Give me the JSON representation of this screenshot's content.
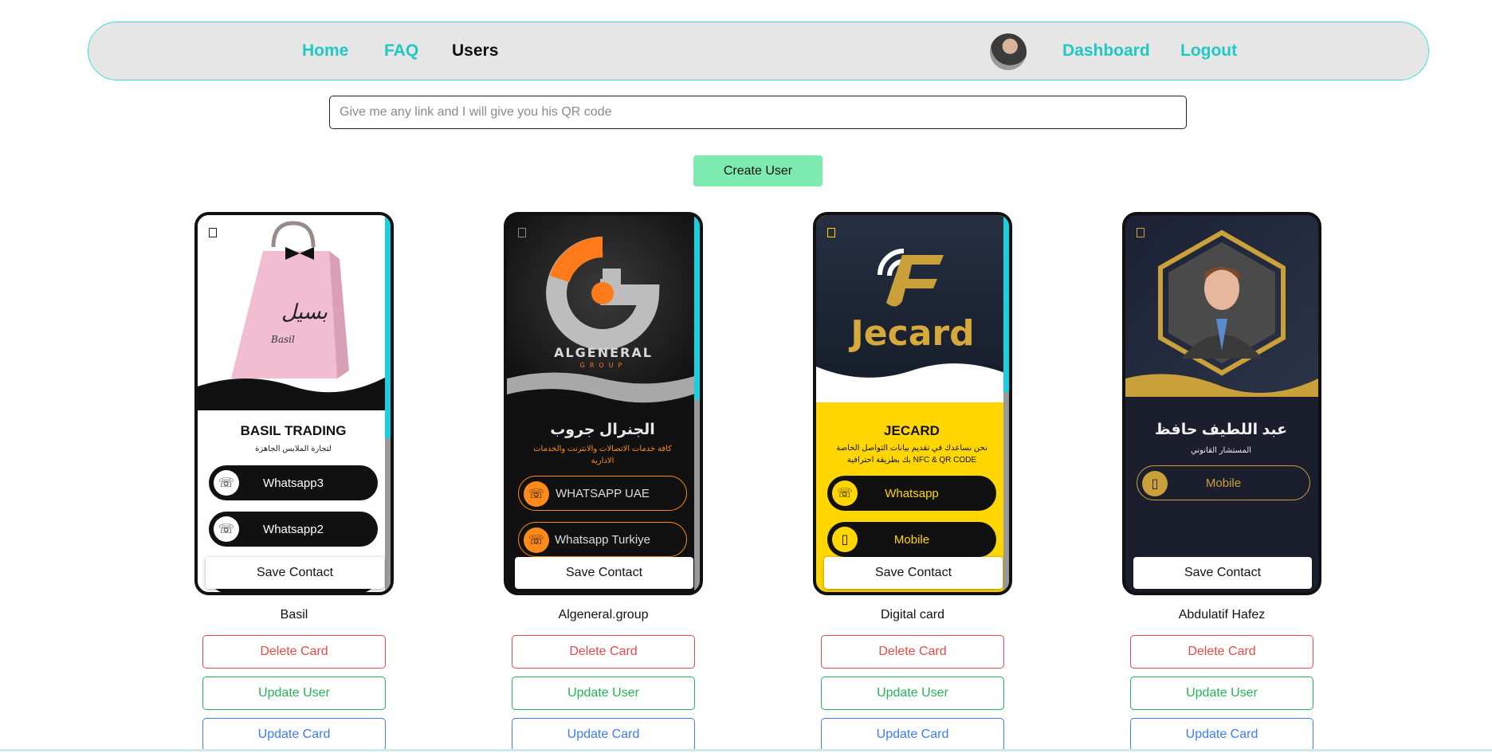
{
  "nav": {
    "home": "Home",
    "faq": "FAQ",
    "users": "Users",
    "dashboard": "Dashboard",
    "logout": "Logout"
  },
  "qr": {
    "placeholder": "Give me any link and I will give you his QR code"
  },
  "create_user": "Create User",
  "save_contact": "Save Contact",
  "actions": {
    "delete": "Delete Card",
    "update_user": "Update User",
    "update_card": "Update Card"
  },
  "cards": [
    {
      "name": "Basil",
      "title": "BASIL TRADING",
      "subtitle": "لتجارة الملابس الجاهزة",
      "brand": "Basil",
      "buttons": [
        "Whatsapp3",
        "Whatsapp2"
      ]
    },
    {
      "name": "Algeneral.group",
      "title": "الجنرال جروب",
      "subtitle": "كافة خدمات الاتصالات والانترنت والخدمات الادارية",
      "brand": "ALGENERAL",
      "brand_sub": "GROUP",
      "buttons": [
        "WHATSAPP UAE",
        "Whatsapp Turkiye"
      ]
    },
    {
      "name": "Digital card",
      "title": "JECARD",
      "subtitle": "نحن نساعدك في تقديم بيانات التواصل الخاصة بك بطريقة احترافية NFC & QR CODE",
      "brand": "Jecard",
      "buttons": [
        "Whatsapp",
        "Mobile"
      ]
    },
    {
      "name": "Abdulatif Hafez",
      "title": "عبد اللطيف حافظ",
      "subtitle": "المستشار القانوني",
      "buttons": [
        "Mobile"
      ]
    }
  ],
  "colors": {
    "accent": "#1fc9c2",
    "create": "#7debb0",
    "delete": "#e24b4b",
    "update_user": "#22b45a",
    "update_card": "#3e7cf0",
    "jecard_yellow": "#ffd600",
    "algeneral_orange": "#ff8a1c",
    "gold": "#c9a03a"
  }
}
